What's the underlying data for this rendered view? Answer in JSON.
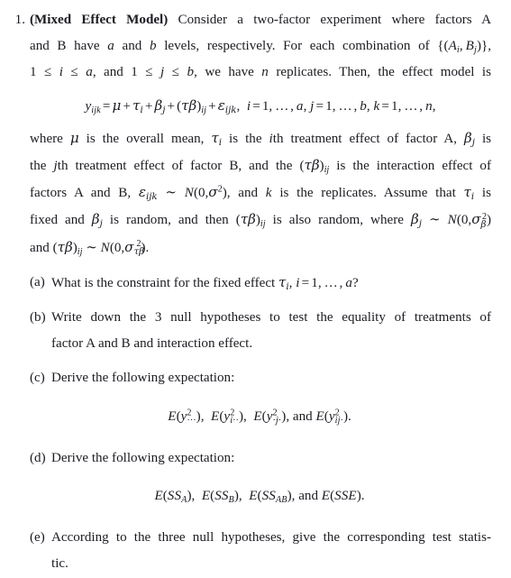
{
  "document": {
    "type": "homework-problem",
    "problem_number": "1.",
    "title": "(Mixed Effect Model)"
  },
  "intro": {
    "line1_rest": "Consider a two-factor experiment where factors A",
    "line2": "and B have a and b levels, respectively. For each combination of {(Aᵢ, Bⱼ)},",
    "line3": "1 ≤ i ≤ a, and 1 ≤ j ≤ b, we have n replicates. Then, the effect model is"
  },
  "model_equation": {
    "lhs": "yᵢⱼₖ",
    "rhs": "μ + τᵢ + βⱼ + (τβ)ᵢⱼ + ϵᵢⱼₖ",
    "ranges": "i = 1, … , a, j = 1, … , b, k = 1, … , n,",
    "full_text": "y_ijk = μ + τ_i + β_j + (τβ)_ij + ϵ_ijk,  i = 1,…,a, j = 1,…,b, k = 1,…,n,"
  },
  "definitions": {
    "line1": "where μ is the overall mean, τᵢ is the ith treatment effect of factor A, βⱼ is",
    "line2": "the jth treatment effect of factor B, and the (τβ)ᵢⱼ is the interaction effect of",
    "line3": "factors A and B, ϵᵢⱼₖ ~ N(0,σ²), and k is the replicates. Assume that τᵢ is",
    "line4": "fixed and βⱼ is random, and then (τβ)ᵢⱼ is also random, where βⱼ ~ N(0,σ²_β)",
    "line5": "and (τβ)ᵢⱼ ~ N(0,σ²_τβ)."
  },
  "items": [
    {
      "label": "(a)",
      "name": "item-a",
      "text": "What is the constraint for the fixed effect τᵢ, i = 1, … , a?"
    },
    {
      "label": "(b)",
      "name": "item-b",
      "line1": "Write down the 3 null hypotheses to test the equality of treatments of",
      "line2": "factor A and B and interaction effect."
    },
    {
      "label": "(c)",
      "name": "item-c",
      "text": "Derive the following expectation:",
      "equation": "E(y²...),  E(y²ᵢ..),  E(y².ⱼ.),  and E(y²ᵢⱼ.)."
    },
    {
      "label": "(d)",
      "name": "item-d",
      "text": "Derive the following expectation:",
      "equation": "E(SS_A),  E(SS_B),  E(SS_AB),  and E(SSE)."
    },
    {
      "label": "(e)",
      "name": "item-e",
      "line1": "According to the three null hypotheses, give the corresponding test statis-",
      "line2": "tic."
    }
  ],
  "colors": {
    "page_background": "#ffffff",
    "text": "#1b1b22"
  }
}
